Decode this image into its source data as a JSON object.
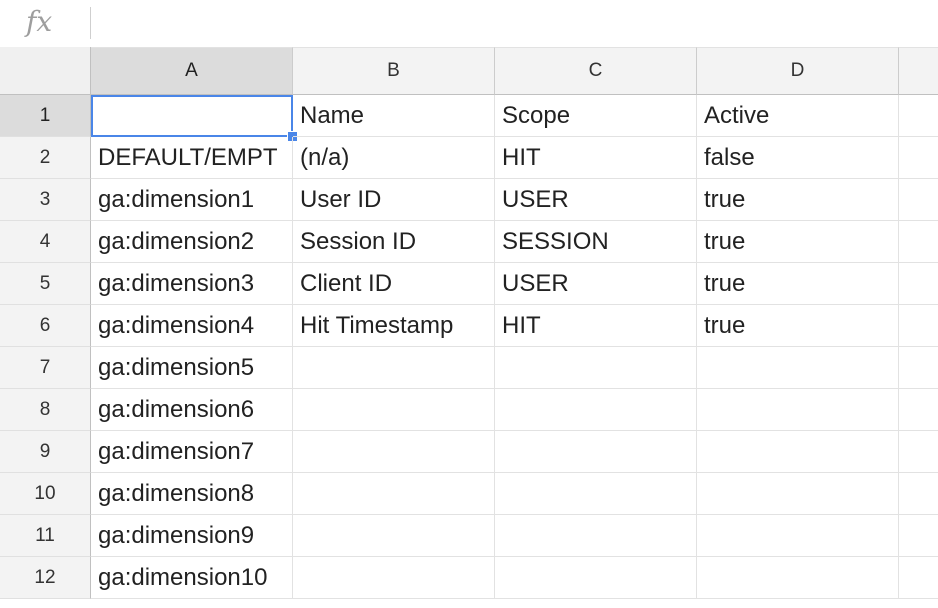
{
  "formula_bar": {
    "icon": "fx-icon",
    "label": "fx",
    "value": ""
  },
  "columns": [
    "A",
    "B",
    "C",
    "D",
    ""
  ],
  "selected_cell": "A1",
  "selection_color": "#4a86e8",
  "rows": [
    {
      "num": "1",
      "cells": [
        "",
        "Name",
        "Scope",
        "Active",
        ""
      ]
    },
    {
      "num": "2",
      "cells": [
        "DEFAULT/EMPT",
        "(n/a)",
        "HIT",
        "false",
        ""
      ]
    },
    {
      "num": "3",
      "cells": [
        "ga:dimension1",
        "User ID",
        "USER",
        "true",
        ""
      ]
    },
    {
      "num": "4",
      "cells": [
        "ga:dimension2",
        "Session ID",
        "SESSION",
        "true",
        ""
      ]
    },
    {
      "num": "5",
      "cells": [
        "ga:dimension3",
        "Client ID",
        "USER",
        "true",
        ""
      ]
    },
    {
      "num": "6",
      "cells": [
        "ga:dimension4",
        "Hit Timestamp",
        "HIT",
        "true",
        ""
      ]
    },
    {
      "num": "7",
      "cells": [
        "ga:dimension5",
        "",
        "",
        "",
        ""
      ]
    },
    {
      "num": "8",
      "cells": [
        "ga:dimension6",
        "",
        "",
        "",
        ""
      ]
    },
    {
      "num": "9",
      "cells": [
        "ga:dimension7",
        "",
        "",
        "",
        ""
      ]
    },
    {
      "num": "10",
      "cells": [
        "ga:dimension8",
        "",
        "",
        "",
        ""
      ]
    },
    {
      "num": "11",
      "cells": [
        "ga:dimension9",
        "",
        "",
        "",
        ""
      ]
    },
    {
      "num": "12",
      "cells": [
        "ga:dimension10",
        "",
        "",
        "",
        ""
      ]
    }
  ]
}
